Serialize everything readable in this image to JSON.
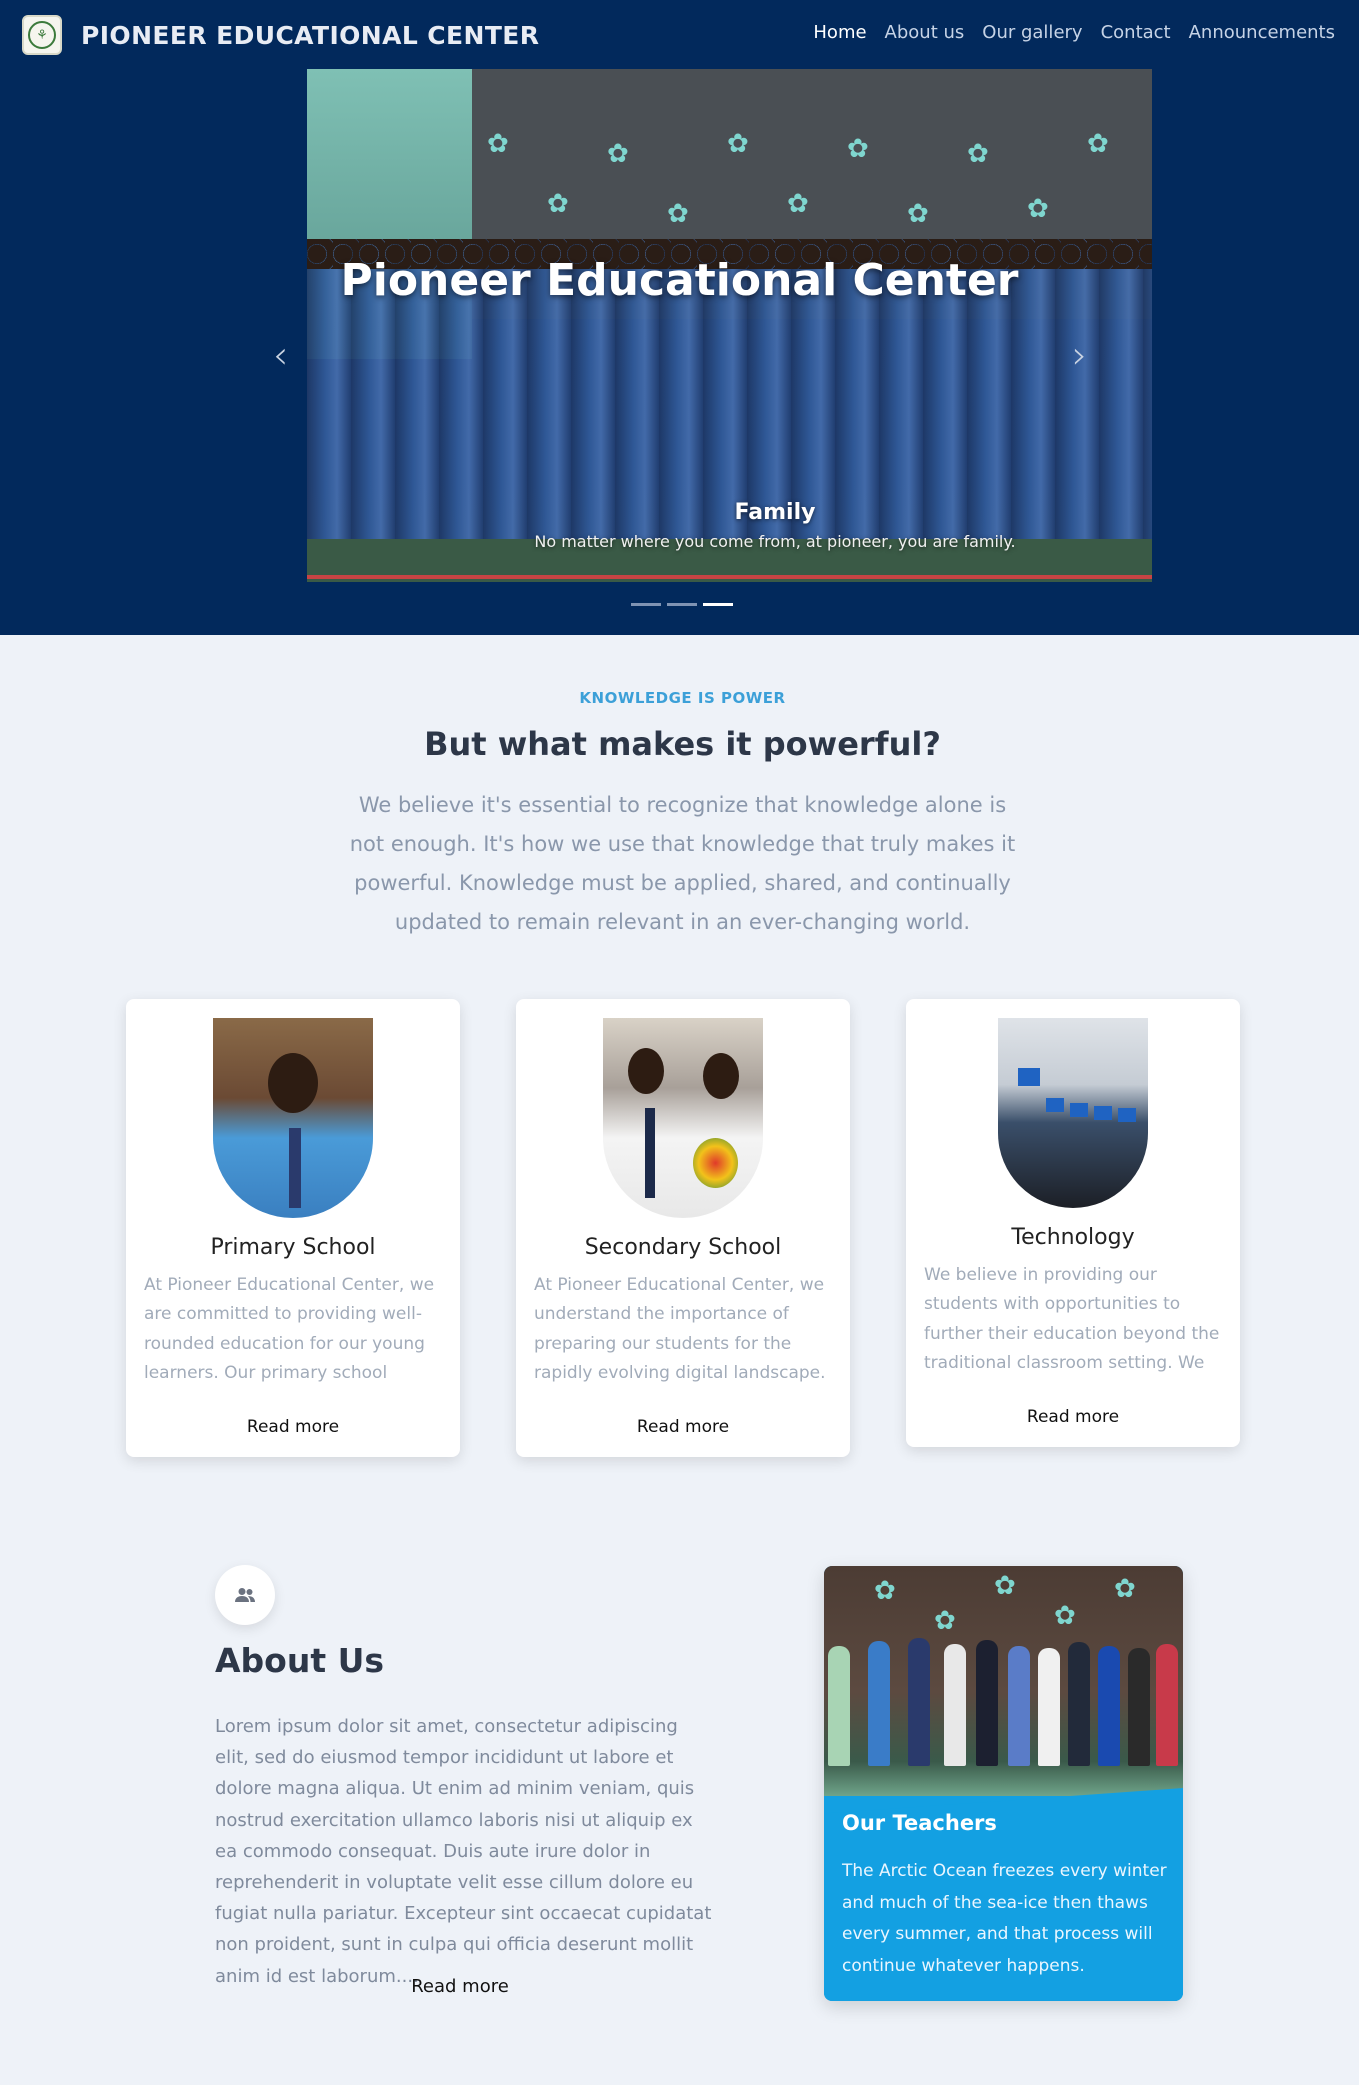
{
  "nav": {
    "brand": "PIONEER EDUCATIONAL CENTER",
    "links": [
      "Home",
      "About us",
      "Our gallery",
      "Contact",
      "Announcements"
    ]
  },
  "hero": {
    "title": "Pioneer Educational Center",
    "caption_title": "Family",
    "caption_text": "No matter where you come from, at pioneer, you are family.",
    "prev_icon": "chevron-left-icon",
    "next_icon": "chevron-right-icon",
    "active_slide": 3,
    "total_slides": 3
  },
  "knowledge": {
    "eyebrow": "KNOWLEDGE IS POWER",
    "headline": "But what makes it powerful?",
    "text": "We believe it's essential to recognize that knowledge alone is not enough. It's how we use that knowledge that truly makes it powerful. Knowledge must be applied, shared, and continually updated to remain relevant in an ever-changing world."
  },
  "cards": [
    {
      "title": "Primary School",
      "text": "At Pioneer Educational Center, we are committed to providing well-rounded education for our young learners. Our primary school section follows the South Sudan ...",
      "read_more": "Read more"
    },
    {
      "title": "Secondary School",
      "text": "At Pioneer Educational Center, we understand the importance of preparing our students for the rapidly evolving digital landscape. That's why our secondary ...",
      "read_more": "Read more"
    },
    {
      "title": "Technology",
      "text": "We believe in providing our students with opportunities to further their education beyond the traditional classroom setting. We offer full stack web development courses for...",
      "read_more": "Read more"
    }
  ],
  "about": {
    "icon": "users-icon",
    "title": "About Us",
    "text": "Lorem ipsum dolor sit amet, consectetur adipiscing elit, sed do eiusmod tempor incididunt ut labore et dolore magna aliqua. Ut enim ad minim veniam, quis nostrud exercitation ullamco laboris nisi ut aliquip ex ea commodo consequat. Duis aute irure dolor in reprehenderit in voluptate velit esse cillum dolore eu fugiat nulla pariatur. Excepteur sint occaecat cupidatat non proident, sunt in culpa qui officia deserunt mollit anim id est laborum....",
    "read_more": "Read more"
  },
  "teachers": {
    "title": "Our Teachers",
    "text": "The Arctic Ocean freezes every winter and much of the sea-ice then thaws every summer, and that process will continue whatever happens."
  },
  "colors": {
    "navy": "#02295c",
    "accent": "#3ca0d8",
    "teacher_blue": "#13a0e2",
    "page_bg": "#eef2f8"
  }
}
